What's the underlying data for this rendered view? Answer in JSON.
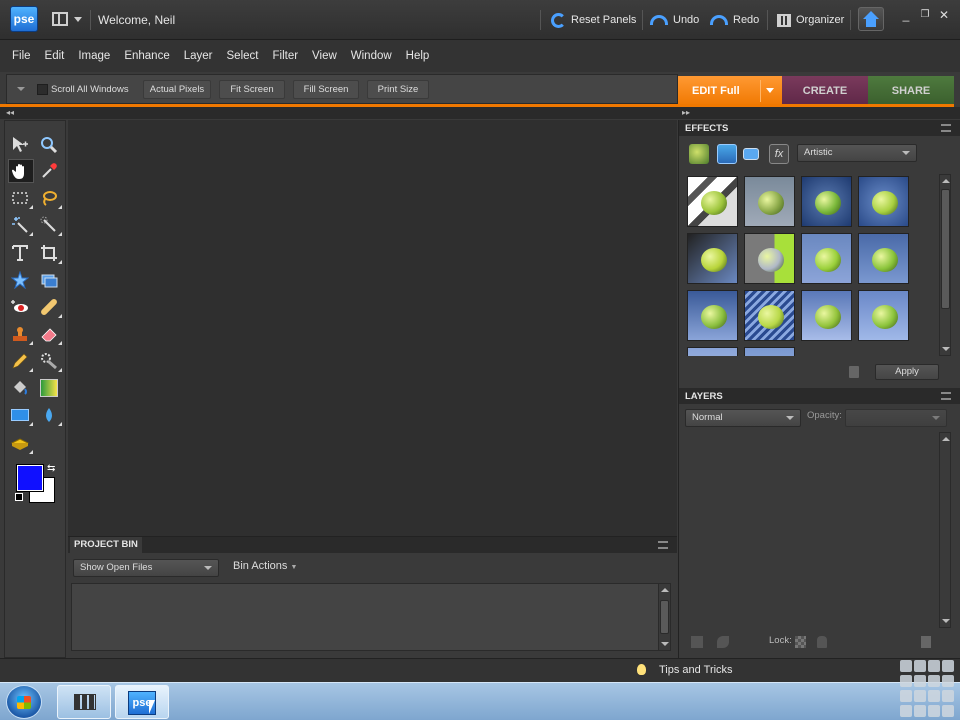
{
  "titlebar": {
    "logo": "pse",
    "welcome": "Welcome, Neil",
    "reset_panels": "Reset Panels",
    "undo": "Undo",
    "redo": "Redo",
    "organizer": "Organizer"
  },
  "menu": [
    "File",
    "Edit",
    "Image",
    "Enhance",
    "Layer",
    "Select",
    "Filter",
    "View",
    "Window",
    "Help"
  ],
  "options_bar": {
    "scroll_all_windows": "Scroll All Windows",
    "buttons": [
      "Actual Pixels",
      "Fit Screen",
      "Fill Screen",
      "Print Size"
    ]
  },
  "mode_tabs": {
    "edit": "EDIT Full",
    "create": "CREATE",
    "share": "SHARE"
  },
  "effects_panel": {
    "title": "EFFECTS",
    "category": "Artistic",
    "apply": "Apply"
  },
  "layers_panel": {
    "title": "LAYERS",
    "blend_mode": "Normal",
    "opacity_label": "Opacity:",
    "lock_label": "Lock:"
  },
  "project_bin": {
    "title": "PROJECT BIN",
    "show": "Show Open Files",
    "bin_actions": "Bin Actions"
  },
  "status": {
    "tips": "Tips and Tricks"
  },
  "taskbar": {
    "pse_label": "pse"
  },
  "colors": {
    "foreground": "#1010ff",
    "background": "#ffffff",
    "accent_edit": "#f07800"
  }
}
